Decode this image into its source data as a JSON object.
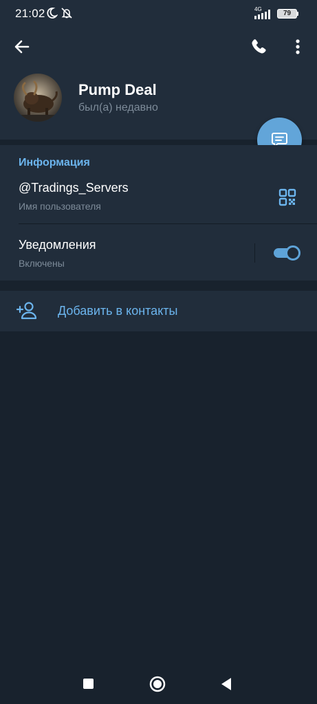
{
  "status_bar": {
    "time": "21:02",
    "network": "4G",
    "battery": "79",
    "icons": [
      "moon-icon",
      "bell-off-icon",
      "signal-icon"
    ]
  },
  "toolbar": {
    "icons": [
      "back-arrow-icon",
      "phone-icon",
      "more-vertical-icon"
    ]
  },
  "profile": {
    "name": "Pump Deal",
    "status": "был(а) недавно"
  },
  "info": {
    "section_title": "Информация",
    "username": "@Tradings_Servers",
    "username_caption": "Имя пользователя",
    "notifications_label": "Уведомления",
    "notifications_state": "Включены",
    "notifications_enabled": true
  },
  "actions": {
    "add_contact": "Добавить в контакты"
  },
  "colors": {
    "accent": "#6cb5ee",
    "fab": "#62a5d9",
    "background": "#18222d",
    "card": "#212d3b",
    "secondary_text": "#7d8b99"
  }
}
